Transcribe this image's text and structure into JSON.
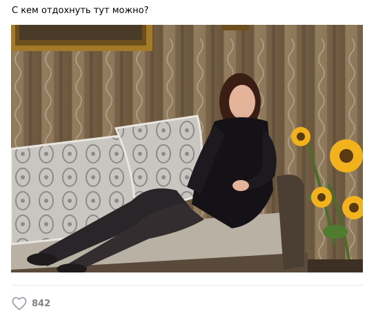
{
  "post": {
    "text": "С кем отдохнуть тут можно?",
    "likes": "842"
  },
  "colors": {
    "text": "#000000",
    "muted": "#828282",
    "divider": "#e7e8ec"
  },
  "icons": {
    "like": "heart-outline-icon"
  }
}
